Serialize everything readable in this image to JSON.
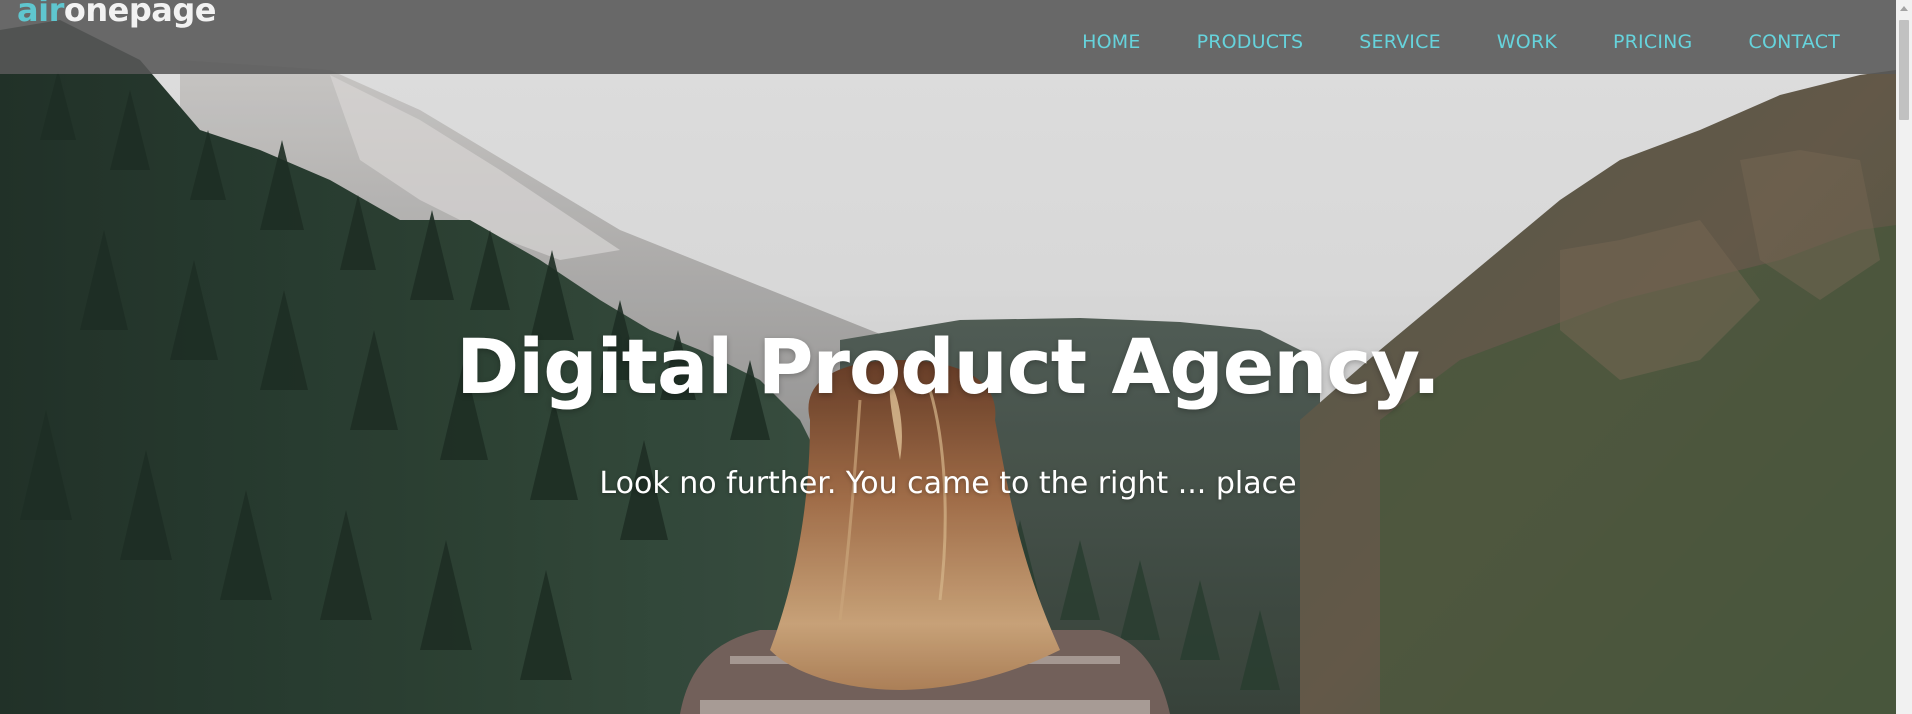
{
  "brand": {
    "logo_accent": "air",
    "logo_main": "onepage",
    "accent_color": "#5fc6cf"
  },
  "nav": {
    "items": [
      {
        "label": "HOME"
      },
      {
        "label": "PRODUCTS"
      },
      {
        "label": "SERVICE"
      },
      {
        "label": "WORK"
      },
      {
        "label": "PRICING"
      },
      {
        "label": "CONTACT"
      }
    ],
    "link_color": "#66d3dc"
  },
  "hero": {
    "headline": "Digital Product Agency.",
    "subline": "Look no further. You came to the right ... place",
    "background_image": "mountain-forest-woman-photo"
  },
  "scrollbar": {
    "icon_up": "chevron-up-icon"
  }
}
